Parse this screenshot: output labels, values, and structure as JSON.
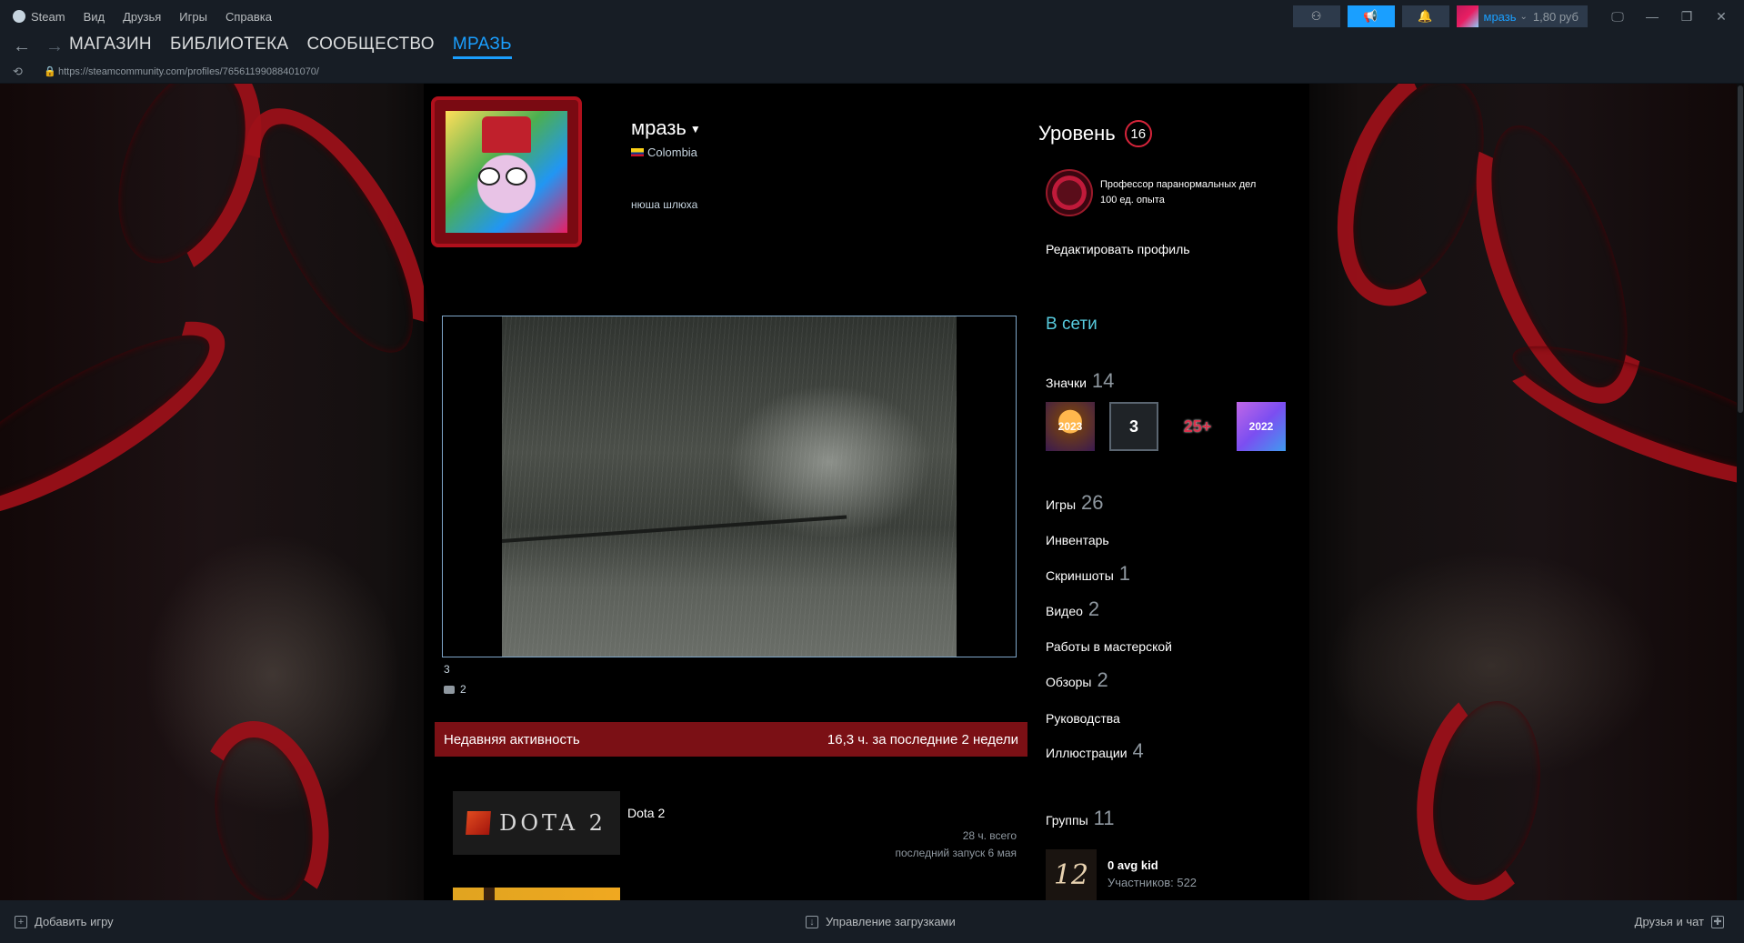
{
  "menu": {
    "app": "Steam",
    "items": [
      "Вид",
      "Друзья",
      "Игры",
      "Справка"
    ]
  },
  "user": {
    "name": "мразь",
    "balance": "1,80 руб"
  },
  "nav": {
    "tabs": [
      "МАГАЗИН",
      "БИБЛИОТЕКА",
      "СООБЩЕСТВО",
      "МРАЗЬ"
    ],
    "active_index": 3
  },
  "url": "https://steamcommunity.com/profiles/76561199088401070/",
  "profile": {
    "name": "мразь",
    "country": "Colombia",
    "summary": "нюша шлюха",
    "showcase_caption": "3",
    "comments_count": "2"
  },
  "level": {
    "label": "Уровень",
    "value": "16"
  },
  "featured_badge": {
    "name": "Профессор паранормальных дел",
    "xp": "100 ед. опыта"
  },
  "edit_profile": "Редактировать профиль",
  "status": "В сети",
  "badges": {
    "label": "Значки",
    "count": "14",
    "items": [
      "2023",
      "3",
      "25+",
      "2022"
    ]
  },
  "stats": [
    {
      "label": "Игры",
      "count": "26"
    },
    {
      "label": "Инвентарь",
      "count": ""
    },
    {
      "label": "Скриншоты",
      "count": "1"
    },
    {
      "label": "Видео",
      "count": "2"
    },
    {
      "label": "Работы в мастерской",
      "count": ""
    },
    {
      "label": "Обзоры",
      "count": "2"
    },
    {
      "label": "Руководства",
      "count": ""
    },
    {
      "label": "Иллюстрации",
      "count": "4"
    }
  ],
  "groups": {
    "label": "Группы",
    "count": "11",
    "first": {
      "name": "0 avg kid",
      "members": "Участников: 522",
      "icon_text": "12"
    }
  },
  "activity": {
    "title": "Недавняя активность",
    "summary": "16,3 ч. за последние 2 недели",
    "games": [
      {
        "name": "Dota 2",
        "logo_text": "DOTA 2",
        "total": "28 ч. всего",
        "last": "последний запуск 6 мая"
      }
    ]
  },
  "bottom": {
    "add_game": "Добавить игру",
    "downloads": "Управление загрузками",
    "friends": "Друзья и чат"
  },
  "colors": {
    "accent": "#1a9fff",
    "activity_bar": "#7b1015",
    "online": "#57cbde"
  }
}
